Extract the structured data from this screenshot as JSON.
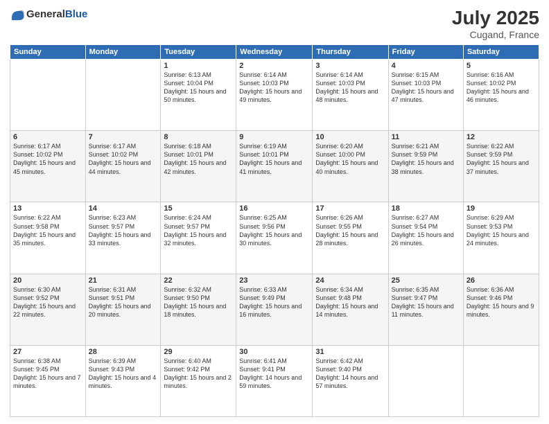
{
  "header": {
    "logo_line1": "General",
    "logo_line2": "Blue",
    "month": "July 2025",
    "location": "Cugand, France"
  },
  "weekdays": [
    "Sunday",
    "Monday",
    "Tuesday",
    "Wednesday",
    "Thursday",
    "Friday",
    "Saturday"
  ],
  "weeks": [
    [
      {
        "day": "",
        "info": ""
      },
      {
        "day": "",
        "info": ""
      },
      {
        "day": "1",
        "info": "Sunrise: 6:13 AM\nSunset: 10:04 PM\nDaylight: 15 hours\nand 50 minutes."
      },
      {
        "day": "2",
        "info": "Sunrise: 6:14 AM\nSunset: 10:03 PM\nDaylight: 15 hours\nand 49 minutes."
      },
      {
        "day": "3",
        "info": "Sunrise: 6:14 AM\nSunset: 10:03 PM\nDaylight: 15 hours\nand 48 minutes."
      },
      {
        "day": "4",
        "info": "Sunrise: 6:15 AM\nSunset: 10:03 PM\nDaylight: 15 hours\nand 47 minutes."
      },
      {
        "day": "5",
        "info": "Sunrise: 6:16 AM\nSunset: 10:02 PM\nDaylight: 15 hours\nand 46 minutes."
      }
    ],
    [
      {
        "day": "6",
        "info": "Sunrise: 6:17 AM\nSunset: 10:02 PM\nDaylight: 15 hours\nand 45 minutes."
      },
      {
        "day": "7",
        "info": "Sunrise: 6:17 AM\nSunset: 10:02 PM\nDaylight: 15 hours\nand 44 minutes."
      },
      {
        "day": "8",
        "info": "Sunrise: 6:18 AM\nSunset: 10:01 PM\nDaylight: 15 hours\nand 42 minutes."
      },
      {
        "day": "9",
        "info": "Sunrise: 6:19 AM\nSunset: 10:01 PM\nDaylight: 15 hours\nand 41 minutes."
      },
      {
        "day": "10",
        "info": "Sunrise: 6:20 AM\nSunset: 10:00 PM\nDaylight: 15 hours\nand 40 minutes."
      },
      {
        "day": "11",
        "info": "Sunrise: 6:21 AM\nSunset: 9:59 PM\nDaylight: 15 hours\nand 38 minutes."
      },
      {
        "day": "12",
        "info": "Sunrise: 6:22 AM\nSunset: 9:59 PM\nDaylight: 15 hours\nand 37 minutes."
      }
    ],
    [
      {
        "day": "13",
        "info": "Sunrise: 6:22 AM\nSunset: 9:58 PM\nDaylight: 15 hours\nand 35 minutes."
      },
      {
        "day": "14",
        "info": "Sunrise: 6:23 AM\nSunset: 9:57 PM\nDaylight: 15 hours\nand 33 minutes."
      },
      {
        "day": "15",
        "info": "Sunrise: 6:24 AM\nSunset: 9:57 PM\nDaylight: 15 hours\nand 32 minutes."
      },
      {
        "day": "16",
        "info": "Sunrise: 6:25 AM\nSunset: 9:56 PM\nDaylight: 15 hours\nand 30 minutes."
      },
      {
        "day": "17",
        "info": "Sunrise: 6:26 AM\nSunset: 9:55 PM\nDaylight: 15 hours\nand 28 minutes."
      },
      {
        "day": "18",
        "info": "Sunrise: 6:27 AM\nSunset: 9:54 PM\nDaylight: 15 hours\nand 26 minutes."
      },
      {
        "day": "19",
        "info": "Sunrise: 6:29 AM\nSunset: 9:53 PM\nDaylight: 15 hours\nand 24 minutes."
      }
    ],
    [
      {
        "day": "20",
        "info": "Sunrise: 6:30 AM\nSunset: 9:52 PM\nDaylight: 15 hours\nand 22 minutes."
      },
      {
        "day": "21",
        "info": "Sunrise: 6:31 AM\nSunset: 9:51 PM\nDaylight: 15 hours\nand 20 minutes."
      },
      {
        "day": "22",
        "info": "Sunrise: 6:32 AM\nSunset: 9:50 PM\nDaylight: 15 hours\nand 18 minutes."
      },
      {
        "day": "23",
        "info": "Sunrise: 6:33 AM\nSunset: 9:49 PM\nDaylight: 15 hours\nand 16 minutes."
      },
      {
        "day": "24",
        "info": "Sunrise: 6:34 AM\nSunset: 9:48 PM\nDaylight: 15 hours\nand 14 minutes."
      },
      {
        "day": "25",
        "info": "Sunrise: 6:35 AM\nSunset: 9:47 PM\nDaylight: 15 hours\nand 11 minutes."
      },
      {
        "day": "26",
        "info": "Sunrise: 6:36 AM\nSunset: 9:46 PM\nDaylight: 15 hours\nand 9 minutes."
      }
    ],
    [
      {
        "day": "27",
        "info": "Sunrise: 6:38 AM\nSunset: 9:45 PM\nDaylight: 15 hours\nand 7 minutes."
      },
      {
        "day": "28",
        "info": "Sunrise: 6:39 AM\nSunset: 9:43 PM\nDaylight: 15 hours\nand 4 minutes."
      },
      {
        "day": "29",
        "info": "Sunrise: 6:40 AM\nSunset: 9:42 PM\nDaylight: 15 hours\nand 2 minutes."
      },
      {
        "day": "30",
        "info": "Sunrise: 6:41 AM\nSunset: 9:41 PM\nDaylight: 14 hours\nand 59 minutes."
      },
      {
        "day": "31",
        "info": "Sunrise: 6:42 AM\nSunset: 9:40 PM\nDaylight: 14 hours\nand 57 minutes."
      },
      {
        "day": "",
        "info": ""
      },
      {
        "day": "",
        "info": ""
      }
    ]
  ]
}
